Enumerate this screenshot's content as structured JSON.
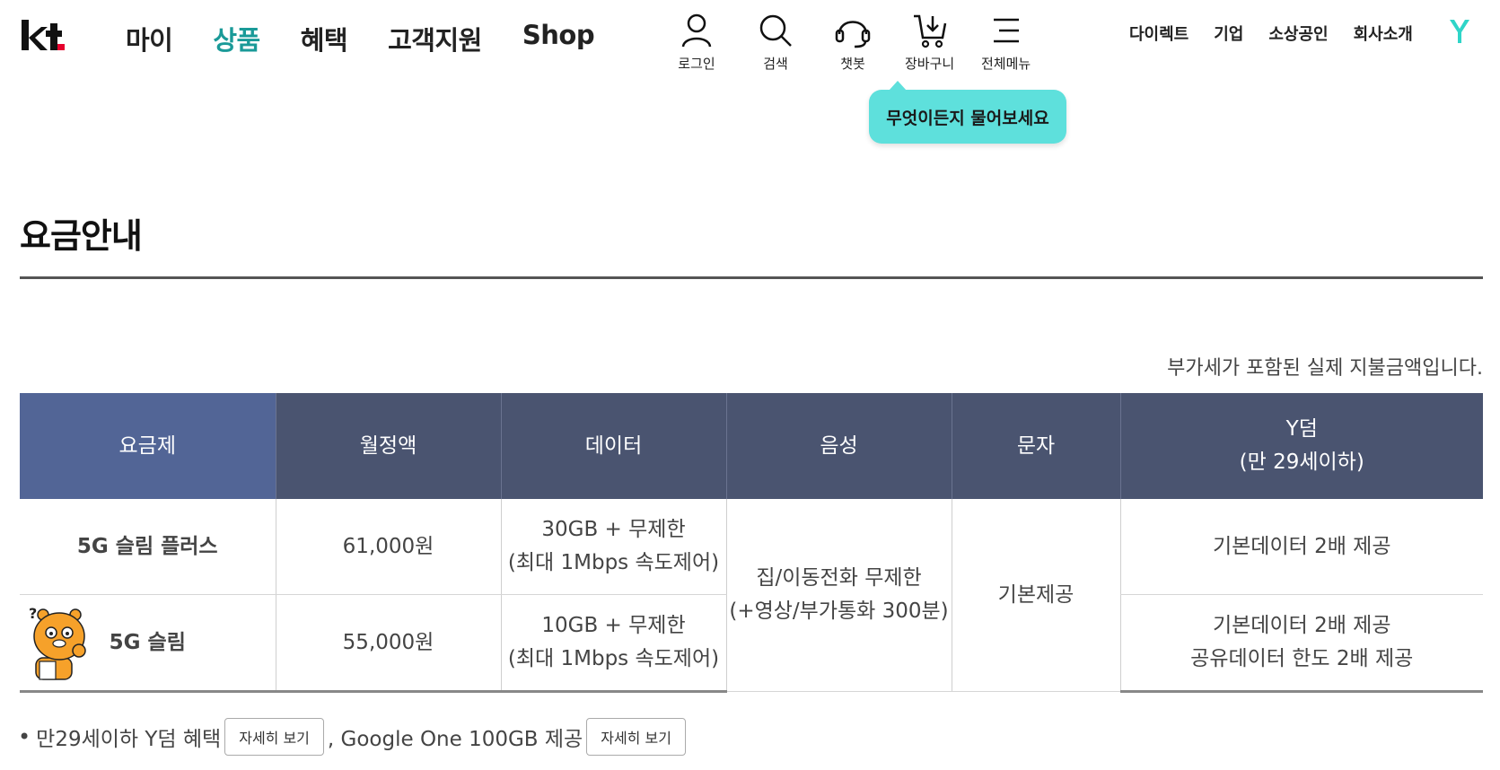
{
  "header": {
    "logo_text": "kt",
    "nav": [
      {
        "label": "마이",
        "active": false
      },
      {
        "label": "상품",
        "active": true
      },
      {
        "label": "혜택",
        "active": false
      },
      {
        "label": "고객지원",
        "active": false
      },
      {
        "label": "Shop",
        "active": false
      }
    ],
    "utilities": [
      {
        "label": "로그인",
        "icon": "person-icon"
      },
      {
        "label": "검색",
        "icon": "search-icon"
      },
      {
        "label": "챗봇",
        "icon": "headset-icon"
      },
      {
        "label": "장바구니",
        "icon": "cart-icon"
      },
      {
        "label": "전체메뉴",
        "icon": "menu-icon"
      }
    ],
    "top_links": [
      "다이렉트",
      "기업",
      "소상공인",
      "회사소개"
    ],
    "chatbot_tooltip": "무엇이든지 물어보세요"
  },
  "page": {
    "title": "요금안내",
    "vat_note": "부가세가 포함된 실제 지불금액입니다."
  },
  "table": {
    "headers": [
      "요금제",
      "월정액",
      "데이터",
      "음성",
      "문자",
      "Y덤",
      "(만 29세이하)"
    ],
    "rows": [
      {
        "plan": "5G 슬림 플러스",
        "price": "61,000원",
        "data_line1": "30GB + 무제한",
        "data_line2": "(최대 1Mbps 속도제어)",
        "ydum_line1": "기본데이터 2배 제공"
      },
      {
        "plan": "5G 슬림",
        "price": "55,000원",
        "data_line1": "10GB + 무제한",
        "data_line2": "(최대 1Mbps 속도제어)",
        "ydum_line1": "기본데이터 2배 제공",
        "ydum_line2": "공유데이터 한도 2배 제공"
      }
    ],
    "voice_line1": "집/이동전화 무제한",
    "voice_line2": "(+영상/부가통화 300분)",
    "sms": "기본제공"
  },
  "footer": {
    "bullet": "•",
    "text1": "만29세이하 Y덤 혜택",
    "button1": "자세히 보기",
    "text2": ", Google One 100GB 제공",
    "button2": "자세히 보기"
  },
  "colors": {
    "accent": "#1a9a98",
    "kt_red": "#e6002d",
    "header_cell": "#4a5470",
    "header_first": "#526596",
    "tooltip": "#5ee0dc"
  }
}
